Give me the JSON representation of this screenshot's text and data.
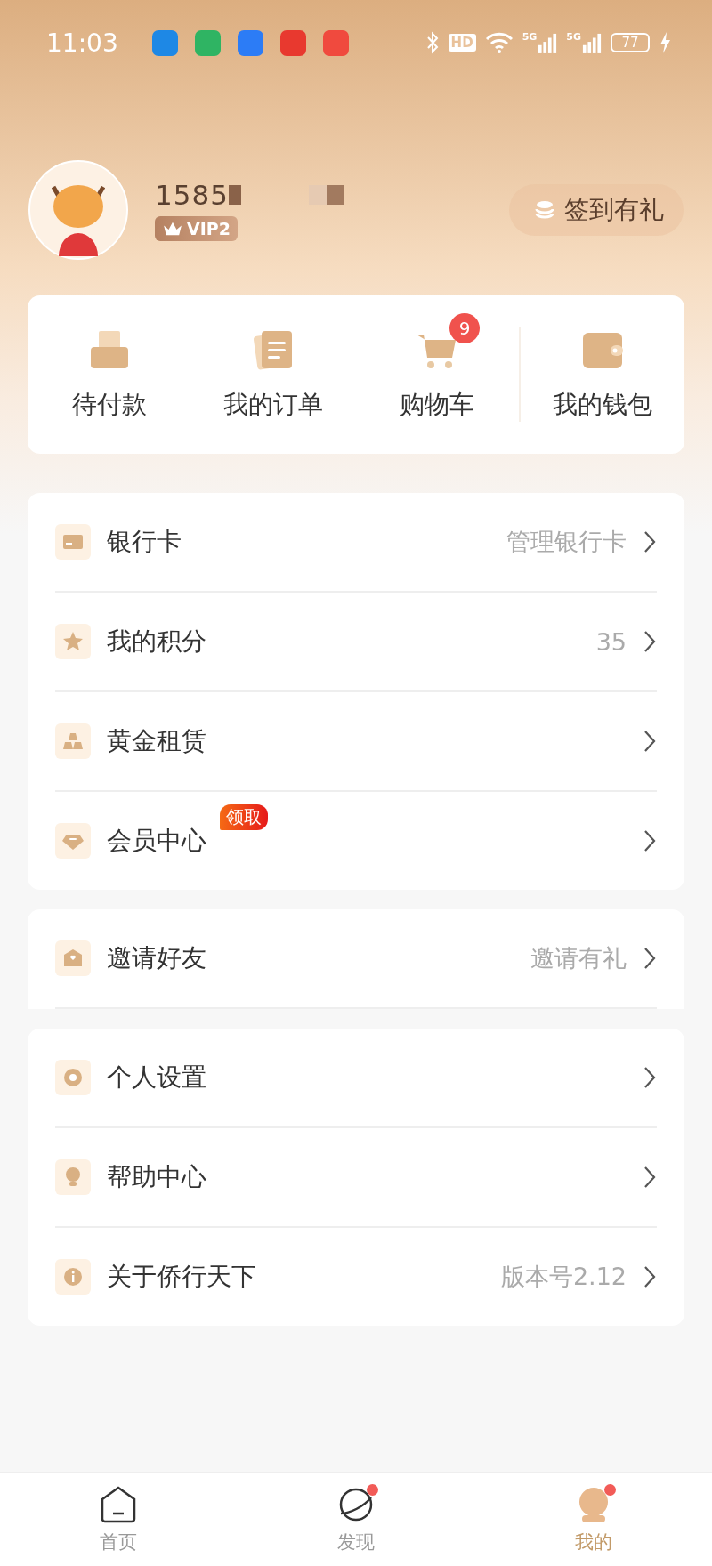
{
  "status_bar": {
    "time": "11:03",
    "apps": [
      {
        "color": "#1e88e5"
      },
      {
        "color": "#2fb463"
      },
      {
        "color": "#2c7cf6"
      },
      {
        "color": "#e8392f"
      },
      {
        "color": "#f04a3e"
      }
    ],
    "hd": "HD",
    "signals": [
      "5G",
      "5G"
    ],
    "battery": "77"
  },
  "profile": {
    "phone": "1585",
    "vip": "VIP2",
    "signin": "签到有礼"
  },
  "quick_actions": [
    {
      "kind": "pay",
      "label": "待付款"
    },
    {
      "kind": "orders",
      "label": "我的订单"
    },
    {
      "kind": "cart",
      "label": "购物车",
      "badge": "9"
    },
    {
      "kind": "wallet",
      "label": "我的钱包"
    }
  ],
  "groups": [
    {
      "clipped": false,
      "items": [
        {
          "kind": "card",
          "label": "银行卡",
          "value": "管理银行卡"
        },
        {
          "kind": "star",
          "label": "我的积分",
          "value": "35"
        },
        {
          "kind": "bars",
          "label": "黄金租赁"
        },
        {
          "kind": "gem",
          "label": "会员中心",
          "badge": "领取"
        }
      ]
    },
    {
      "clipped": true,
      "items": [
        {
          "kind": "invite",
          "label": "邀请好友",
          "value": "邀请有礼"
        }
      ]
    },
    {
      "clipped": false,
      "items": [
        {
          "kind": "settings",
          "label": "个人设置"
        },
        {
          "kind": "help",
          "label": "帮助中心"
        },
        {
          "kind": "info",
          "label": "关于侨行天下",
          "value": "版本号2.12"
        }
      ]
    }
  ],
  "tabs": [
    {
      "kind": "home",
      "label": "首页",
      "selected": false,
      "dot": false
    },
    {
      "kind": "discover",
      "label": "发现",
      "selected": false,
      "dot": true
    },
    {
      "kind": "me",
      "label": "我的",
      "selected": true,
      "dot": true
    }
  ]
}
